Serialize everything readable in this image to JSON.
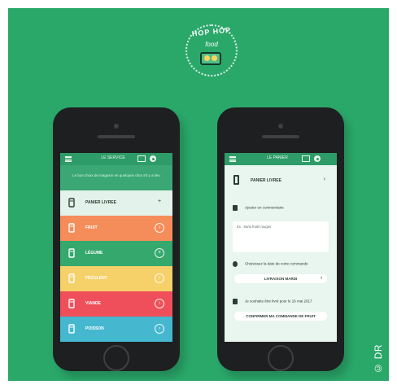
{
  "logo": {
    "line1": "HOP HOP",
    "line2": "food"
  },
  "credit": "© DR",
  "left_screen": {
    "header_title": "LE SERVICE",
    "intro": "Le bon choix de magasin en quelques clics s'il y a lieu",
    "rows": [
      {
        "label": "PANIER LIVREE",
        "color": "#e3f2ea",
        "icon": "bottle-icon",
        "style": "plain",
        "action": "+"
      },
      {
        "label": "FRUIT",
        "color": "#f58d5b",
        "icon": "apple-icon",
        "style": "colored",
        "action": "›"
      },
      {
        "label": "LÉGUME",
        "color": "#34a86d",
        "icon": "carrot-icon",
        "style": "colored",
        "action": "+"
      },
      {
        "label": "FÉCULENT",
        "color": "#f6d069",
        "icon": "grain-icon",
        "style": "colored",
        "action": "›"
      },
      {
        "label": "VIANDE",
        "color": "#ef4f5a",
        "icon": "meat-icon",
        "style": "colored",
        "action": "›"
      },
      {
        "label": "POISSON",
        "color": "#45b8cf",
        "icon": "fish-icon",
        "style": "colored",
        "action": "›"
      }
    ]
  },
  "right_screen": {
    "header_title": "LE PANIER",
    "product_label": "PANIER LIVREE",
    "item1": "Ajouter un commentaire",
    "textarea_placeholder": "Ex : Sans fruits rouges",
    "item2": "Choisissez la date de votre commande",
    "date_button": "LIVRAISON MARDI",
    "item3": "Je souhaite être livré pour le 16 mai 2017",
    "confirm_button": "CONFIRMER MA COMMANDE DE FRUIT"
  },
  "colors": {
    "background": "#2aa86a",
    "phone": "#1d1f20",
    "topbar": "#2e9c68"
  }
}
